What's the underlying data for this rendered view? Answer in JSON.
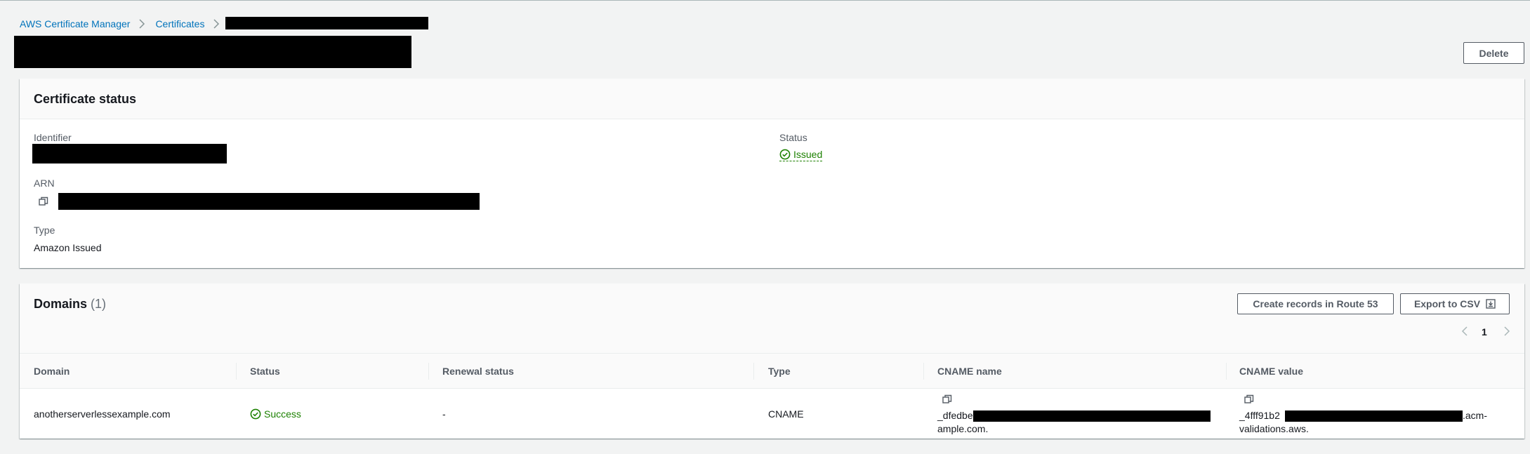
{
  "breadcrumb": {
    "items": [
      "AWS Certificate Manager",
      "Certificates"
    ]
  },
  "header": {
    "delete_label": "Delete"
  },
  "certificate_status": {
    "title": "Certificate status",
    "identifier_label": "Identifier",
    "arn_label": "ARN",
    "type_label": "Type",
    "type_value": "Amazon Issued",
    "status_label": "Status",
    "status_value": "Issued"
  },
  "domains": {
    "title": "Domains",
    "count": "(1)",
    "create_records_label": "Create records in Route 53",
    "export_label": "Export to CSV",
    "page_number": "1",
    "columns": [
      "Domain",
      "Status",
      "Renewal status",
      "Type",
      "CNAME name",
      "CNAME value"
    ],
    "rows": [
      {
        "domain": "anotherserverlessexample.com",
        "status": "Success",
        "renewal_status": "-",
        "type": "CNAME",
        "cname_name_prefix": "_dfedbe",
        "cname_name_suffix": "ample.com.",
        "cname_value_prefix": "_4fff91b2",
        "cname_value_tail": ".acm-",
        "cname_value_suffix": "validations.aws."
      }
    ]
  },
  "colors": {
    "link": "#0073bb",
    "success": "#1d8102",
    "border": "#545b64",
    "background": "#f2f3f3"
  },
  "icons": [
    "chevron-right-icon",
    "copy-icon",
    "status-success-icon",
    "download-icon",
    "chevron-left-icon"
  ]
}
